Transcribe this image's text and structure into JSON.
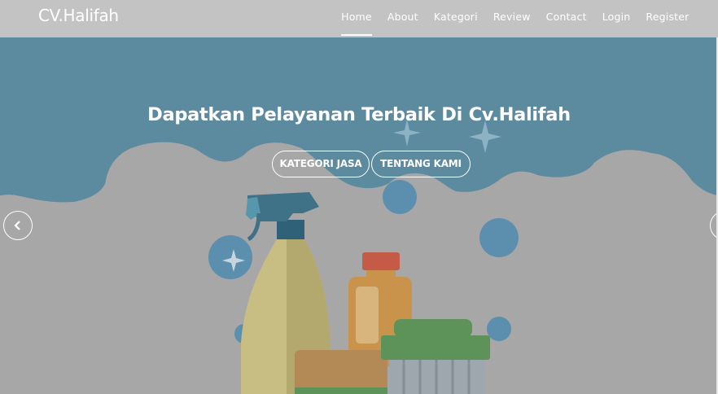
{
  "brand": "CV.Halifah",
  "nav": {
    "items": [
      {
        "label": "Home",
        "active": true
      },
      {
        "label": "About"
      },
      {
        "label": "Kategori"
      },
      {
        "label": "Review"
      },
      {
        "label": "Contact"
      },
      {
        "label": "Login"
      },
      {
        "label": "Register"
      }
    ]
  },
  "hero": {
    "title": "Dapatkan Pelayanan Terbaik Di Cv.Halifah",
    "buttons": {
      "kategori": "KATEGORI JASA",
      "tentang": "TENTANG KAMI"
    },
    "prev_icon": "chevron-left-icon",
    "next_icon": "chevron-right-icon",
    "illustration": "cleaning-supplies-illustration"
  },
  "colors": {
    "navbar": "#c3c3c3",
    "hero_overlay": "#a7a7a7",
    "cloud_blue": "#5c8ba0",
    "bubble_blue": "#5b8fad",
    "spray_blue": "#3f7286",
    "bottle_tan": "#c8b07a",
    "bottle_orange": "#c9934c",
    "cap_red": "#c55a47",
    "brush_green": "#5d9358",
    "sponge_brown": "#b38a55"
  }
}
